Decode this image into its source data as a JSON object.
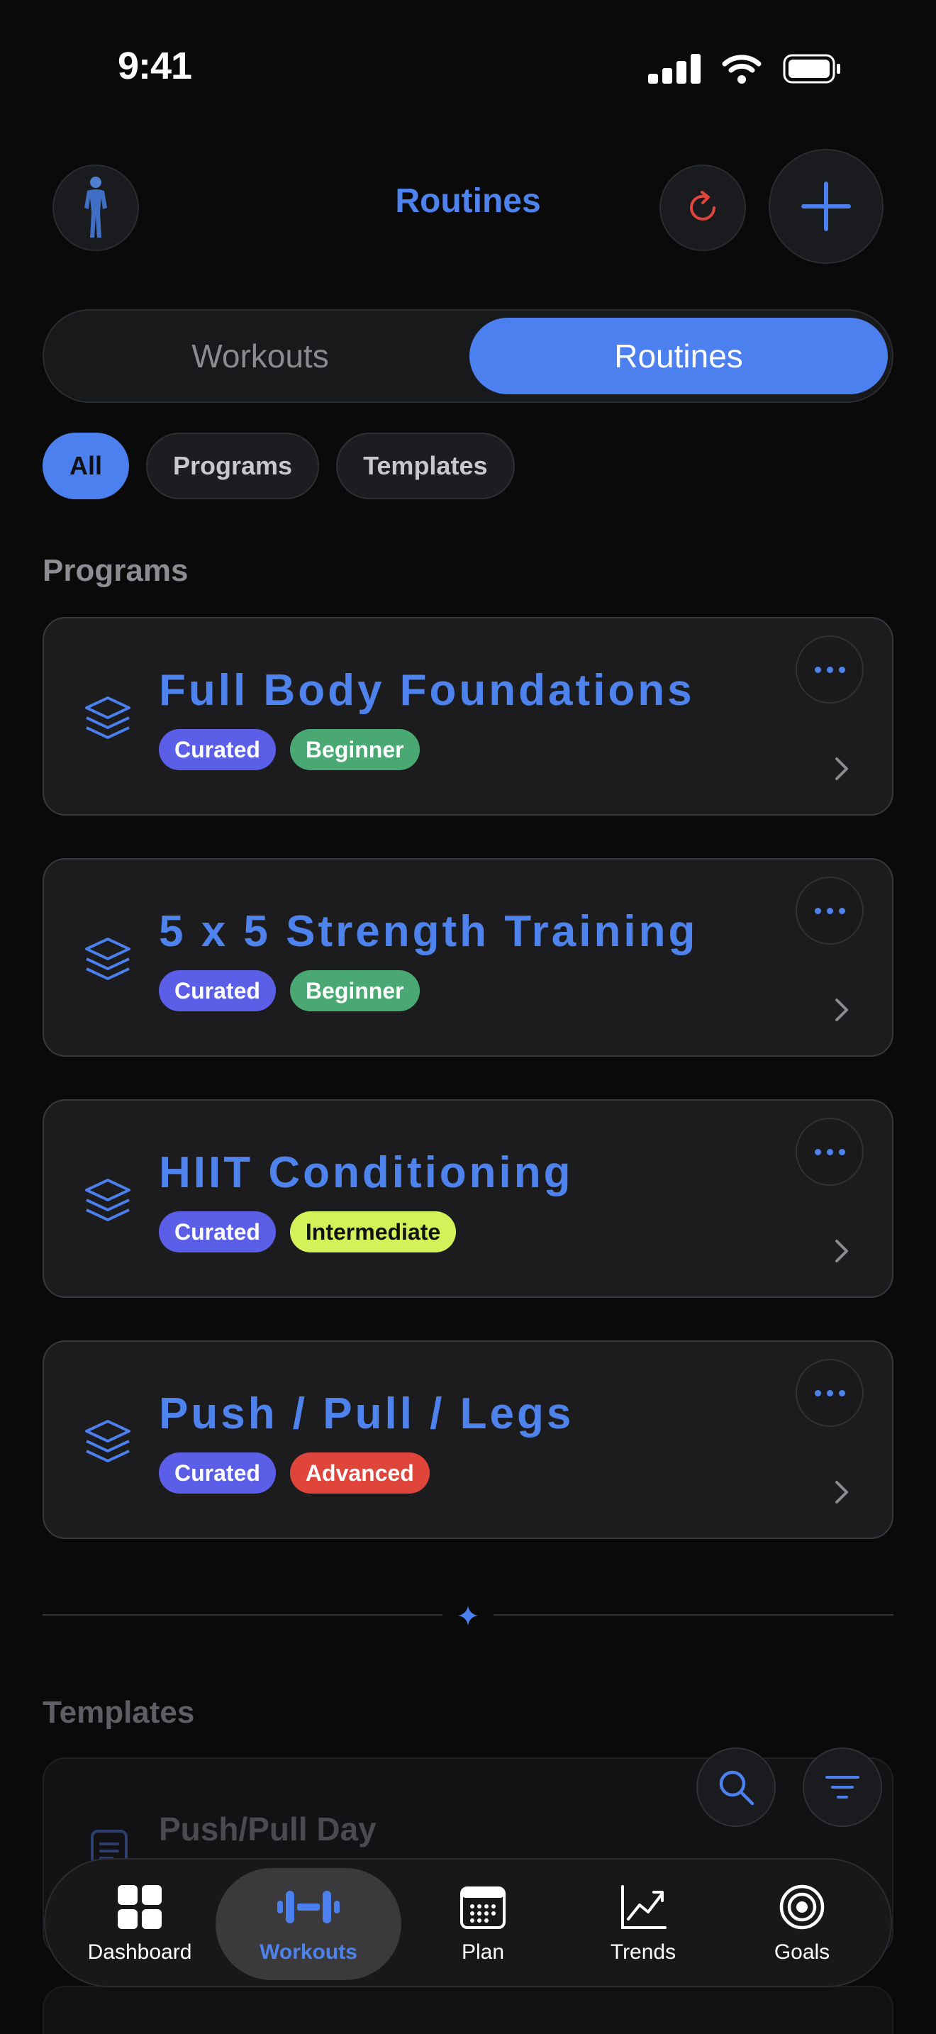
{
  "status_bar": {
    "time": "9:41"
  },
  "header": {
    "title": "Routines"
  },
  "segmented": {
    "left": "Workouts",
    "right": "Routines",
    "selected": "Routines"
  },
  "filters": [
    {
      "label": "All",
      "active": true
    },
    {
      "label": "Programs",
      "active": false
    },
    {
      "label": "Templates",
      "active": false
    }
  ],
  "sections": {
    "programs": "Programs",
    "templates": "Templates"
  },
  "programs": [
    {
      "title": "Full Body Foundations",
      "badges": [
        {
          "label": "Curated",
          "kind": "curated"
        },
        {
          "label": "Beginner",
          "kind": "beginner"
        }
      ]
    },
    {
      "title": "5 x 5 Strength Training",
      "badges": [
        {
          "label": "Curated",
          "kind": "curated"
        },
        {
          "label": "Beginner",
          "kind": "beginner"
        }
      ]
    },
    {
      "title": "HIIT Conditioning",
      "badges": [
        {
          "label": "Curated",
          "kind": "curated"
        },
        {
          "label": "Intermediate",
          "kind": "intermediate"
        }
      ]
    },
    {
      "title": "Push / Pull / Legs",
      "badges": [
        {
          "label": "Curated",
          "kind": "curated"
        },
        {
          "label": "Advanced",
          "kind": "advanced"
        }
      ]
    }
  ],
  "templates": [
    {
      "title": "Push/Pull Day"
    }
  ],
  "tabbar": {
    "items": [
      {
        "label": "Dashboard",
        "icon": "grid-icon"
      },
      {
        "label": "Workouts",
        "icon": "dumbbell-icon",
        "active": true
      },
      {
        "label": "Plan",
        "icon": "calendar-icon"
      },
      {
        "label": "Trends",
        "icon": "chart-line-icon"
      },
      {
        "label": "Goals",
        "icon": "target-icon"
      }
    ]
  },
  "colors": {
    "accent": "#4b80ee",
    "background": "#0a0a0b",
    "curated": "#5b5ee6",
    "beginner": "#4aa973",
    "intermediate": "#d4f15a",
    "advanced": "#e0453b",
    "refresh": "#e0453b"
  }
}
